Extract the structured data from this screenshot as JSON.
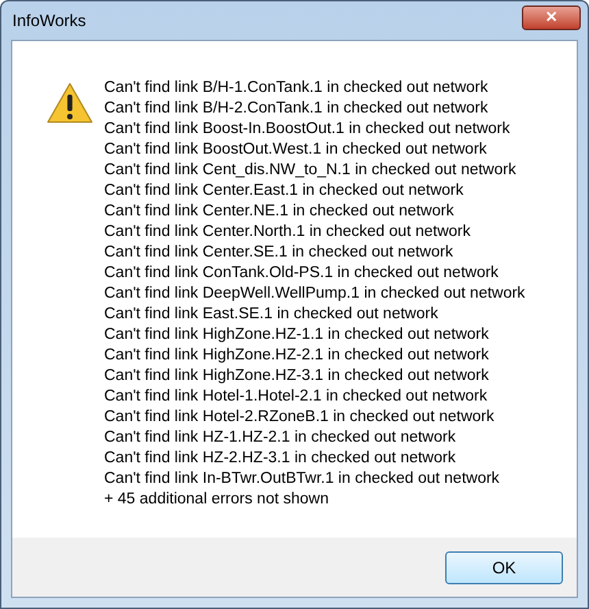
{
  "window": {
    "title": "InfoWorks",
    "close": "✕"
  },
  "messages": [
    "Can't find link B/H-1.ConTank.1 in checked out network",
    "Can't find link B/H-2.ConTank.1 in checked out network",
    "Can't find link Boost-In.BoostOut.1 in checked out network",
    "Can't find link BoostOut.West.1 in checked out network",
    "Can't find link Cent_dis.NW_to_N.1 in checked out network",
    "Can't find link Center.East.1 in checked out network",
    "Can't find link Center.NE.1 in checked out network",
    "Can't find link Center.North.1 in checked out network",
    "Can't find link Center.SE.1 in checked out network",
    "Can't find link ConTank.Old-PS.1 in checked out network",
    "Can't find link DeepWell.WellPump.1 in checked out network",
    "Can't find link East.SE.1 in checked out network",
    "Can't find link HighZone.HZ-1.1 in checked out network",
    "Can't find link HighZone.HZ-2.1 in checked out network",
    "Can't find link HighZone.HZ-3.1 in checked out network",
    "Can't find link Hotel-1.Hotel-2.1 in checked out network",
    "Can't find link Hotel-2.RZoneB.1 in checked out network",
    "Can't find link HZ-1.HZ-2.1 in checked out network",
    "Can't find link HZ-2.HZ-3.1 in checked out network",
    "Can't find link In-BTwr.OutBTwr.1 in checked out network",
    "+ 45 additional errors not shown"
  ],
  "buttons": [
    "OK"
  ]
}
